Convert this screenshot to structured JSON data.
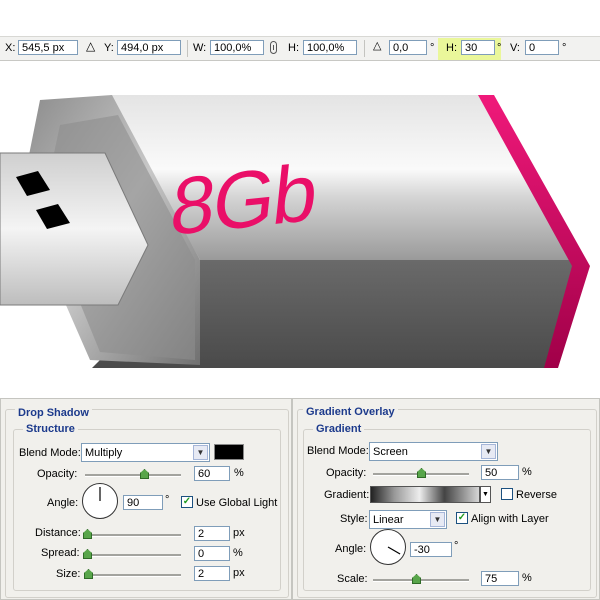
{
  "options_bar": {
    "x_label": "X:",
    "x_value": "545,5 px",
    "y_label": "Y:",
    "y_value": "494,0 px",
    "w_label": "W:",
    "w_value": "100,0%",
    "h_label": "H:",
    "h_value": "100,0%",
    "rotate_value": "0,0",
    "hskew_label": "H:",
    "hskew_value": "30",
    "vskew_label": "V:",
    "vskew_value": "0",
    "degree": "°"
  },
  "artwork": {
    "label": "8Gb",
    "accent_color": "#ea0f68"
  },
  "drop_shadow": {
    "title": "Drop Shadow",
    "group": "Structure",
    "blend_mode_label": "Blend Mode:",
    "blend_mode": "Multiply",
    "color": "#000000",
    "opacity_label": "Opacity:",
    "opacity": "60",
    "opacity_level": 60,
    "angle_label": "Angle:",
    "angle": "90",
    "angle_degrees": 90,
    "use_global_light": "Use Global Light",
    "distance_label": "Distance:",
    "distance": "2",
    "spread_label": "Spread:",
    "spread": "0",
    "size_label": "Size:",
    "size": "2",
    "px": "px",
    "pct": "%",
    "deg": "°"
  },
  "gradient_overlay": {
    "title": "Gradient Overlay",
    "group": "Gradient",
    "blend_mode_label": "Blend Mode:",
    "blend_mode": "Screen",
    "opacity_label": "Opacity:",
    "opacity": "50",
    "opacity_level": 50,
    "gradient_label": "Gradient:",
    "reverse": "Reverse",
    "style_label": "Style:",
    "style": "Linear",
    "align_with_layer": "Align with Layer",
    "angle_label": "Angle:",
    "angle": "-30",
    "angle_degrees": -30,
    "scale_label": "Scale:",
    "scale": "75",
    "pct": "%",
    "deg": "°"
  }
}
